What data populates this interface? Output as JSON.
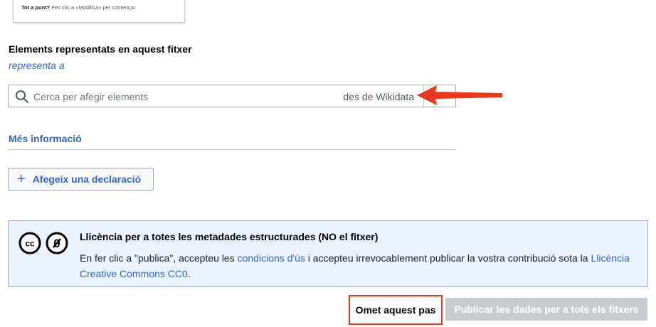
{
  "thumbnail": {
    "hint_bold": "Tot a punt?",
    "hint_text": " Fes clic a «Modifica» per començar."
  },
  "depicts": {
    "heading": "Elements representats en aquest fitxer",
    "property_link": "representa a",
    "search_placeholder": "Cerca per afegir elements",
    "search_suffix": "des de Wikidata",
    "more_info": "Més informació",
    "add_statement_label": "Afegeix una declaració",
    "add_statement_icon": "+"
  },
  "license": {
    "title": "Llicència per a totes les metadades estructurades (NO el fitxer)",
    "text_before": "En fer clic a \"publica\", accepteu les ",
    "terms_link": "condicions d'ús",
    "text_middle": " i accepteu irrevocablement publicar la vostra contribució sota la ",
    "license_link": "Llicència Creative Commons CC0",
    "text_after": ".",
    "cc_icon_text": "cc",
    "zero_icon_text": "0"
  },
  "actions": {
    "skip_label": "Omet aquest pas",
    "publish_label": "Publicar les dades per a tots els fitxers"
  },
  "colors": {
    "link": "#3366cc",
    "annotation": "#e8391e",
    "license_bg": "#eaf3ff",
    "disabled": "#c8ccd1"
  }
}
